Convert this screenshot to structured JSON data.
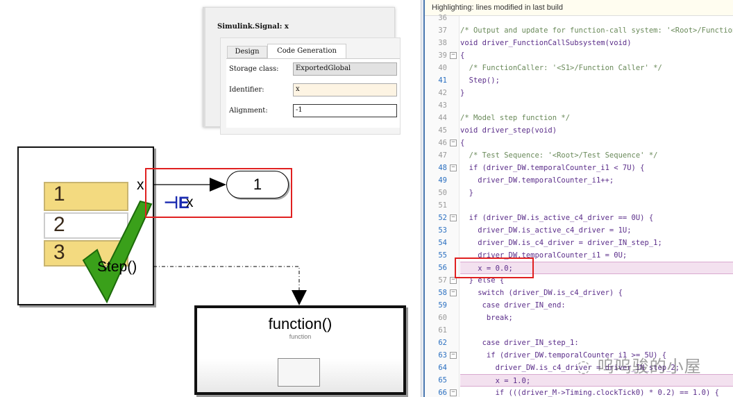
{
  "dialog": {
    "title": "Simulink.Signal: x",
    "tabs": [
      {
        "label": "Design",
        "active": false
      },
      {
        "label": "Code Generation",
        "active": true
      }
    ],
    "fields": [
      {
        "label": "Storage class:",
        "value": "ExportedGlobal"
      },
      {
        "label": "Identifier:",
        "value": "x"
      },
      {
        "label": "Alignment:",
        "value": "-1"
      }
    ]
  },
  "diagram": {
    "test_sequence_rows": [
      "1",
      "2",
      "3"
    ],
    "signal_label": "x",
    "signal_object_label": "x",
    "outport_label": "1",
    "step_label": "Step()",
    "function_block_title": "function()",
    "function_block_subtitle": "function",
    "colors": {
      "table_row": "#f3da80",
      "check": "#3aa01a",
      "highlight_box": "#e02020"
    }
  },
  "code_view": {
    "highlighting_label": "Highlighting: lines modified in last build",
    "highlight_color": "#f3e1ef",
    "lines": [
      {
        "n": "36",
        "text": "",
        "mod": false
      },
      {
        "n": "37",
        "text": "/* Output and update for function-call system: '<Root>/Function-Call Subsystem' */",
        "mod": false,
        "comment": true
      },
      {
        "n": "38",
        "text": "void driver_FunctionCallSubsystem(void)",
        "mod": false
      },
      {
        "n": "39",
        "text": "{",
        "mod": false,
        "fold": true
      },
      {
        "n": "40",
        "text": "  /* FunctionCaller: '<S1>/Function Caller' */",
        "mod": false,
        "comment": true
      },
      {
        "n": "41",
        "text": "  Step();",
        "mod": true
      },
      {
        "n": "42",
        "text": "}",
        "mod": false
      },
      {
        "n": "43",
        "text": "",
        "mod": false
      },
      {
        "n": "44",
        "text": "/* Model step function */",
        "mod": false,
        "comment": true
      },
      {
        "n": "45",
        "text": "void driver_step(void)",
        "mod": false
      },
      {
        "n": "46",
        "text": "{",
        "mod": false,
        "fold": true
      },
      {
        "n": "47",
        "text": "  /* Test Sequence: '<Root>/Test Sequence' */",
        "mod": false,
        "comment": true
      },
      {
        "n": "48",
        "text": "  if (driver_DW.temporalCounter_i1 < 7U) {",
        "mod": true,
        "fold": true
      },
      {
        "n": "49",
        "text": "    driver_DW.temporalCounter_i1++;",
        "mod": true
      },
      {
        "n": "50",
        "text": "  }",
        "mod": false
      },
      {
        "n": "51",
        "text": "",
        "mod": false
      },
      {
        "n": "52",
        "text": "  if (driver_DW.is_active_c4_driver == 0U) {",
        "mod": true,
        "fold": true
      },
      {
        "n": "53",
        "text": "    driver_DW.is_active_c4_driver = 1U;",
        "mod": true
      },
      {
        "n": "54",
        "text": "    driver_DW.is_c4_driver = driver_IN_step_1;",
        "mod": true
      },
      {
        "n": "55",
        "text": "    driver_DW.temporalCounter_i1 = 0U;",
        "mod": true
      },
      {
        "n": "56",
        "text": "    x = 0.0;",
        "mod": true,
        "highlight": true
      },
      {
        "n": "57",
        "text": "  } else {",
        "mod": false,
        "fold": true
      },
      {
        "n": "58",
        "text": "    switch (driver_DW.is_c4_driver) {",
        "mod": true,
        "fold": true
      },
      {
        "n": "59",
        "text": "     case driver_IN_end:",
        "mod": true
      },
      {
        "n": "60",
        "text": "      break;",
        "mod": false
      },
      {
        "n": "61",
        "text": "",
        "mod": false
      },
      {
        "n": "62",
        "text": "     case driver_IN_step_1:",
        "mod": true
      },
      {
        "n": "63",
        "text": "      if (driver_DW.temporalCounter_i1 >= 5U) {",
        "mod": true,
        "fold": true
      },
      {
        "n": "64",
        "text": "        driver_DW.is_c4_driver = driver_IN_step_2;",
        "mod": true
      },
      {
        "n": "65",
        "text": "        x = 1.0;",
        "mod": true,
        "highlight": true
      },
      {
        "n": "66",
        "text": "        if (((driver_M->Timing.clockTick0) * 0.2) == 1.0) {",
        "mod": true,
        "fold": true
      }
    ]
  },
  "watermark": "呜呜骏的小屋"
}
